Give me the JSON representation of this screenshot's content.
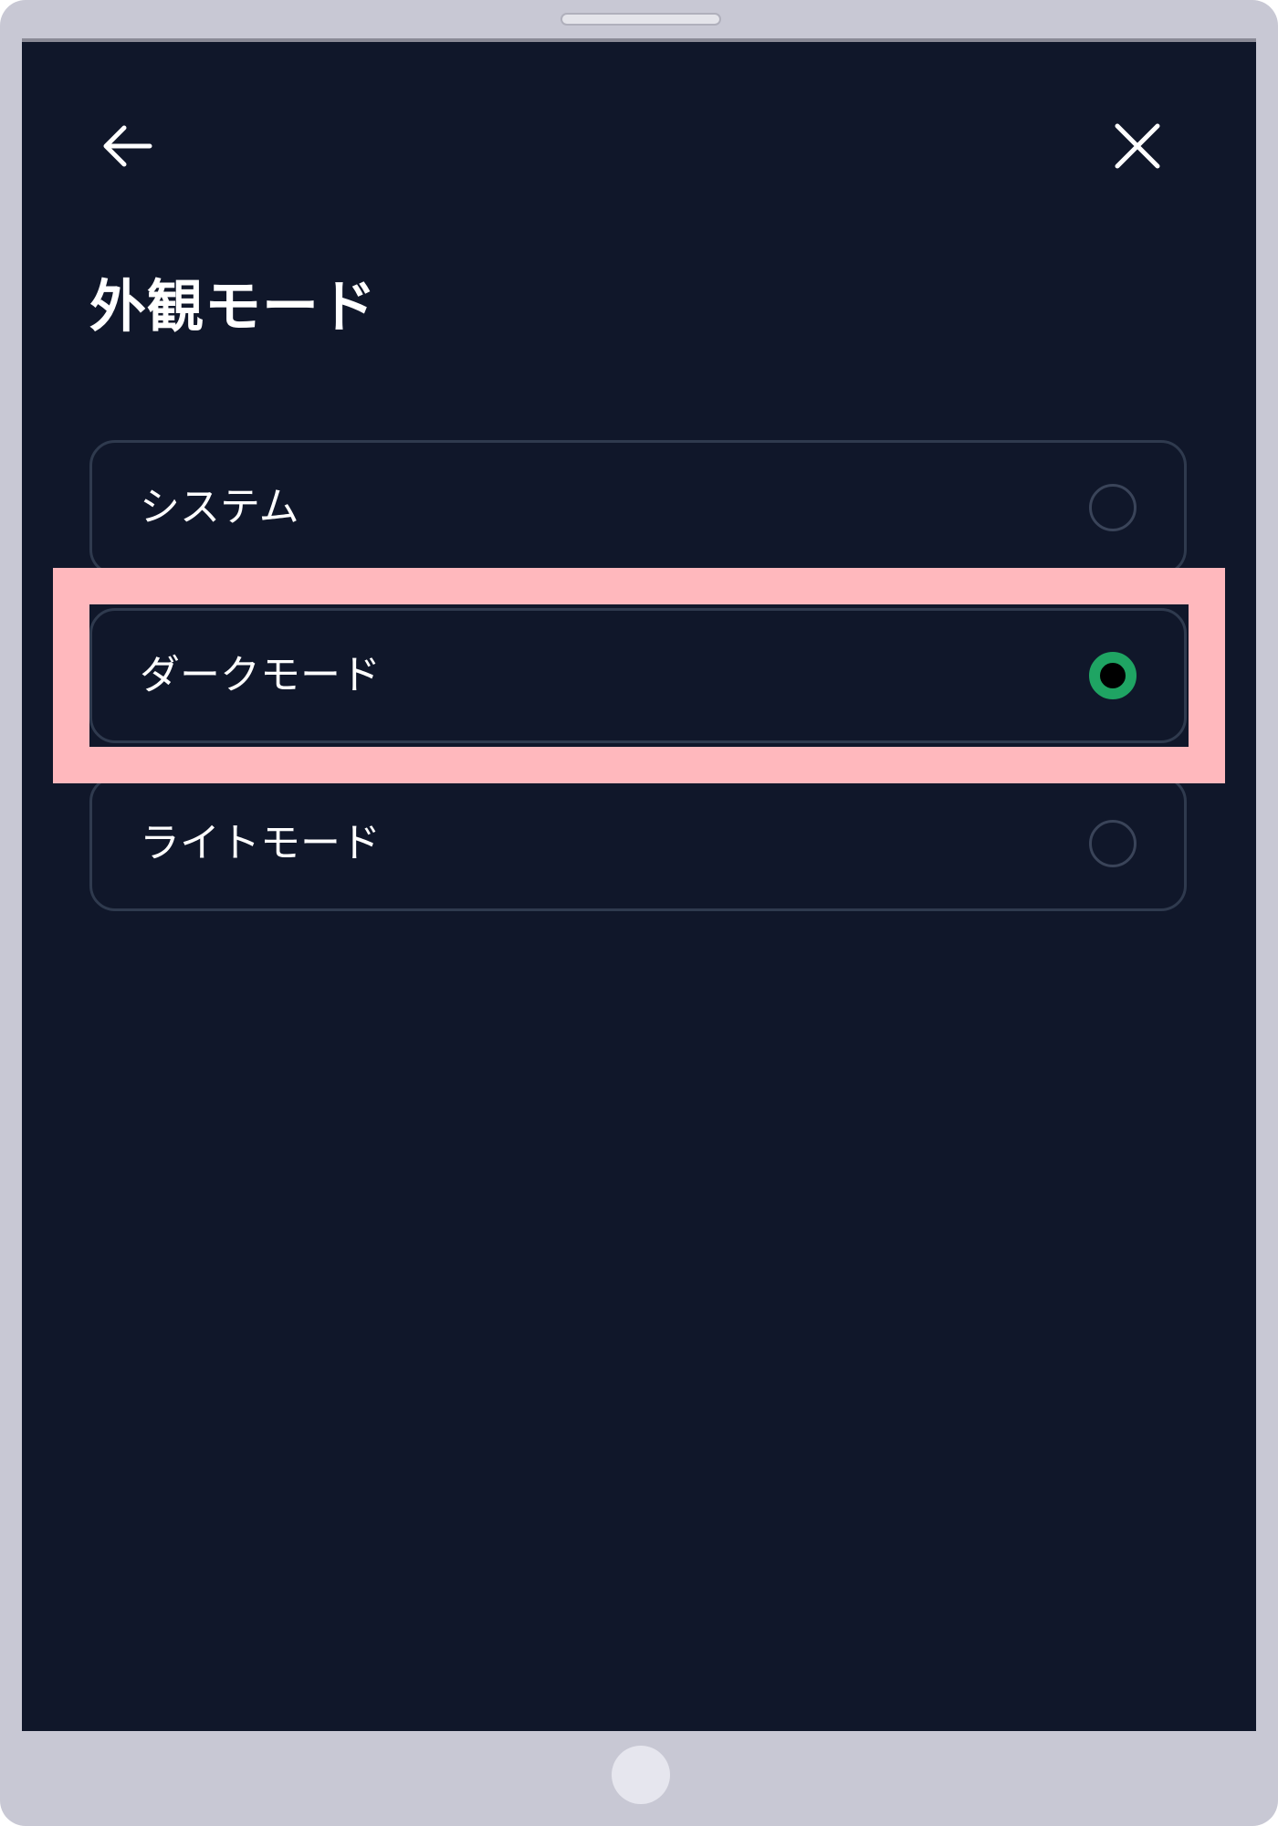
{
  "header": {
    "back_icon": "arrow-left-icon",
    "close_icon": "close-icon",
    "title": "外観モード"
  },
  "options": [
    {
      "label": "システム",
      "selected": false
    },
    {
      "label": "ダークモード",
      "selected": true
    },
    {
      "label": "ライトモード",
      "selected": false
    }
  ],
  "colors": {
    "screen_background": "#10172a",
    "accent_selected": "#1fa463",
    "highlight": "#ffb8bd",
    "device_frame": "#c8c8d4"
  }
}
